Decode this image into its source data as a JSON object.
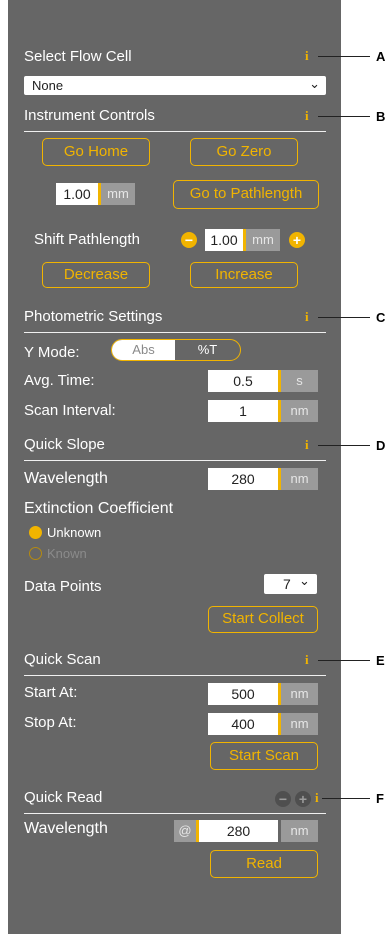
{
  "flow_cell": {
    "title": "Select Flow Cell",
    "selected": "None"
  },
  "instrument": {
    "title": "Instrument Controls",
    "go_home": "Go Home",
    "go_zero": "Go Zero",
    "pathlength_value": "1.00",
    "pathlength_unit": "mm",
    "go_to_pathlength": "Go to Pathlength",
    "shift_label": "Shift Pathlength",
    "shift_value": "1.00",
    "shift_unit": "mm",
    "decrease": "Decrease",
    "increase": "Increase"
  },
  "photometric": {
    "title": "Photometric Settings",
    "ymode_label": "Y Mode:",
    "abs": "Abs",
    "pct_t": "%T",
    "avg_time_label": "Avg. Time:",
    "avg_time_value": "0.5",
    "avg_time_unit": "s",
    "scan_interval_label": "Scan Interval:",
    "scan_interval_value": "1",
    "scan_interval_unit": "nm"
  },
  "quick_slope": {
    "title": "Quick Slope",
    "wavelength_label": "Wavelength",
    "wavelength_value": "280",
    "wavelength_unit": "nm",
    "ext_coeff_label": "Extinction Coefficient",
    "unknown": "Unknown",
    "known": "Known",
    "data_points_label": "Data Points",
    "data_points_value": "7",
    "start_collect": "Start Collect"
  },
  "quick_scan": {
    "title": "Quick Scan",
    "start_label": "Start At:",
    "start_value": "500",
    "start_unit": "nm",
    "stop_label": "Stop At:",
    "stop_value": "400",
    "stop_unit": "nm",
    "start_scan": "Start Scan"
  },
  "quick_read": {
    "title": "Quick Read",
    "wavelength_label": "Wavelength",
    "at": "@",
    "wavelength_value": "280",
    "wavelength_unit": "nm",
    "read": "Read"
  },
  "info_glyph": "i",
  "callouts": {
    "a": "A",
    "b": "B",
    "c": "C",
    "d": "D",
    "e": "E",
    "f": "F"
  },
  "colors": {
    "panel": "#666666",
    "accent": "#f1b400",
    "unit_bg": "#9a9a9a"
  }
}
